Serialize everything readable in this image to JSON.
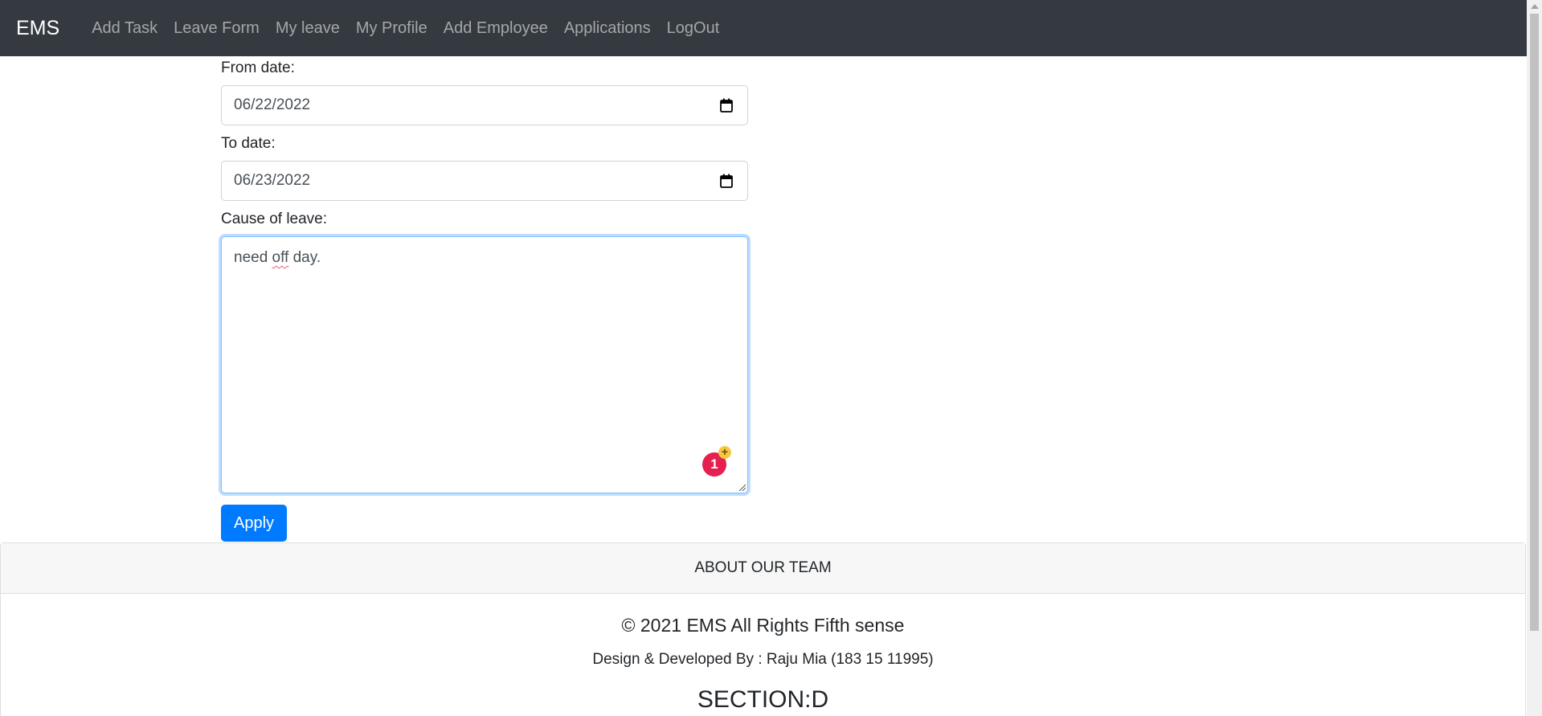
{
  "navbar": {
    "brand": "EMS",
    "links": [
      {
        "label": "Add Task"
      },
      {
        "label": "Leave Form"
      },
      {
        "label": "My leave"
      },
      {
        "label": "My Profile"
      },
      {
        "label": "Add Employee"
      },
      {
        "label": "Applications"
      },
      {
        "label": "LogOut"
      }
    ]
  },
  "form": {
    "from_label": "From date:",
    "from_value": "06/22/2022",
    "to_label": "To date:",
    "to_value": "06/23/2022",
    "cause_label": "Cause of leave:",
    "cause_text_before": "need ",
    "cause_text_misspelled": "off",
    "cause_text_after": " day.",
    "grammar_count": "1",
    "grammar_plus": "+",
    "apply_label": "Apply"
  },
  "footer": {
    "header": "ABOUT OUR TEAM",
    "copyright": "© 2021 EMS All Rights Fifth sense",
    "developer": "Design & Developed By : Raju Mia (183 15 11995)",
    "section": "SECTION:D"
  },
  "colors": {
    "navbar_bg": "#343a40",
    "primary": "#007bff",
    "grammar_badge": "#e3204f"
  },
  "icons": {
    "date_picker": "calendar-icon",
    "textarea_resize": "resize-handle-icon"
  }
}
